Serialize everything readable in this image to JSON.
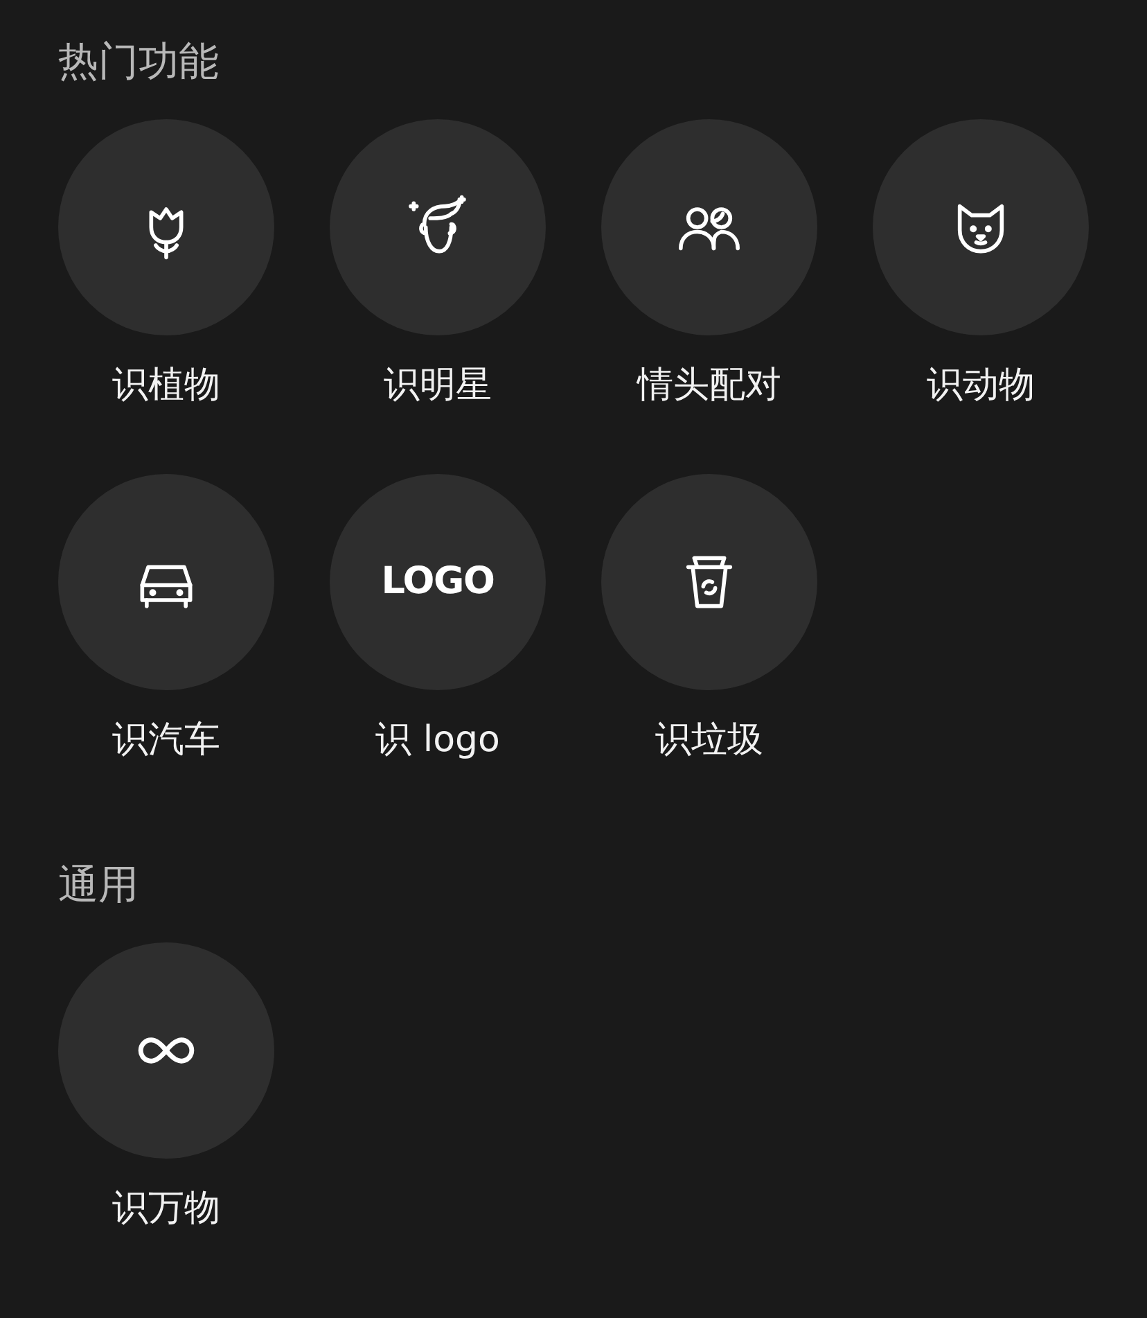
{
  "sections": [
    {
      "title": "热门功能",
      "items": [
        {
          "kind": "icon",
          "label": "识植物"
        },
        {
          "kind": "icon",
          "label": "识明星"
        },
        {
          "kind": "icon",
          "label": "情头配对"
        },
        {
          "kind": "icon",
          "label": "识动物"
        },
        {
          "kind": "icon",
          "label": "识汽车"
        },
        {
          "kind": "text",
          "icon_text": "LOGO",
          "label": "识 logo"
        },
        {
          "kind": "icon",
          "label": "识垃圾"
        }
      ]
    },
    {
      "title": "通用",
      "items": [
        {
          "kind": "icon",
          "label": "识万物"
        }
      ]
    }
  ]
}
